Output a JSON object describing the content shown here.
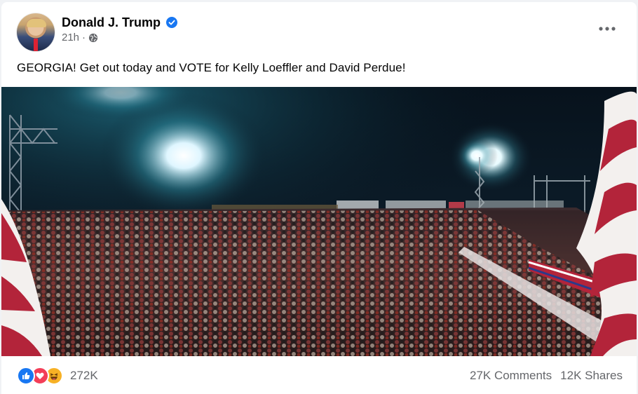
{
  "post": {
    "author": "Donald J. Trump",
    "verified_icon": "verified-badge-icon",
    "time": "21h",
    "separator": "·",
    "audience_icon": "globe-icon",
    "text": "GEORGIA! Get out today and VOTE for Kelly Loeffler and David Perdue!",
    "photo": "night rally crowd with stadium lights and american flags"
  },
  "reactions": {
    "icons": [
      "like-icon",
      "love-icon",
      "haha-icon"
    ],
    "count": "272K"
  },
  "stats": {
    "comments": "27K Comments",
    "shares": "12K Shares"
  },
  "colors": {
    "accent": "#1877f2",
    "text": "#050505",
    "secondary": "#65676b"
  }
}
